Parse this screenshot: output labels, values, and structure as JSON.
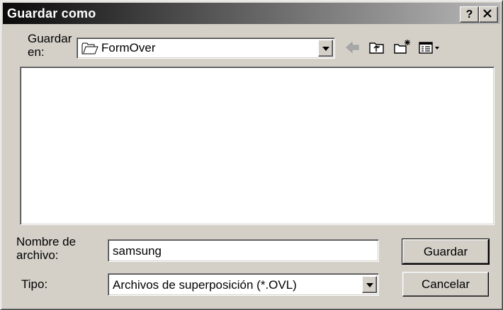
{
  "window": {
    "title": "Guardar como",
    "help_button": "?",
    "close_button": "✕"
  },
  "save_in": {
    "label": "Guardar en:",
    "label_line1": "Guardar",
    "label_line2": "en:",
    "value": "FormOver"
  },
  "filename": {
    "label_line1": "Nombre de",
    "label_line2": "archivo:",
    "value": "samsung"
  },
  "filetype": {
    "label": "Tipo:",
    "value": "Archivos de superposición (*.OVL)"
  },
  "buttons": {
    "save": "Guardar",
    "cancel": "Cancelar"
  },
  "toolbar": {
    "icons": [
      "back-arrow-icon",
      "up-folder-icon",
      "new-folder-icon",
      "view-menu-icon"
    ]
  }
}
